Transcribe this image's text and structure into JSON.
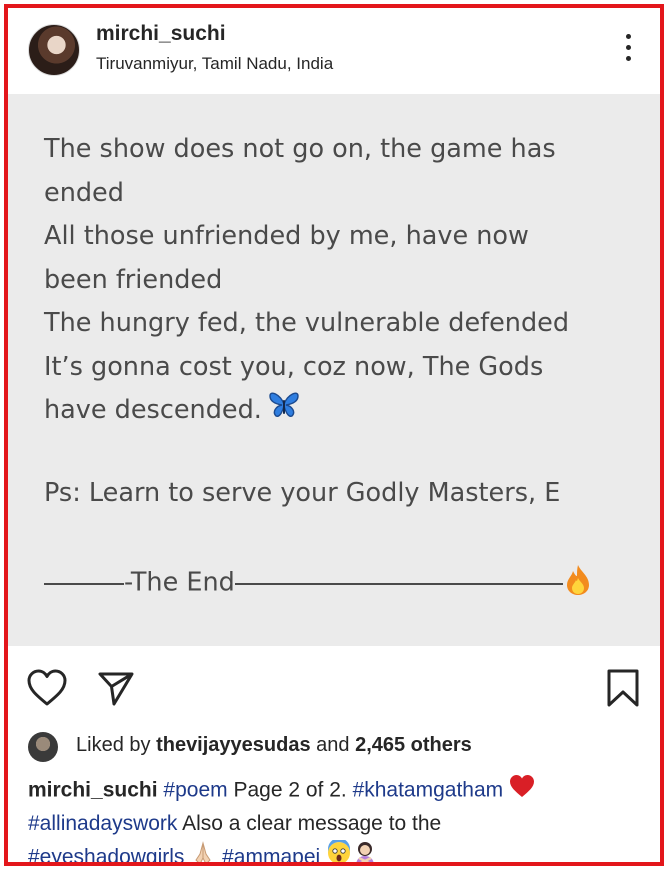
{
  "header": {
    "username": "mirchi_suchi",
    "location": "Tiruvanmiyur, Tamil Nadu, India"
  },
  "post": {
    "poem_lines": [
      "The show does not go on, the game has",
      "ended",
      "All those unfriended by me, have now",
      "been friended",
      "The hungry fed, the vulnerable defended",
      "It’s gonna cost you, coz now, The Gods",
      "have descended."
    ],
    "ps_line": "Ps: Learn to serve your Godly Masters, E",
    "end_text": "-The End",
    "background": "#ebebeb",
    "text_color": "#4a4a4a"
  },
  "actions": {
    "like_icon": "heart-icon",
    "share_icon": "send-icon",
    "save_icon": "bookmark-icon"
  },
  "likes": {
    "prefix": "Liked by ",
    "liker": "thevijayyesudas",
    "middle": " and ",
    "count": "2,465 others"
  },
  "caption": {
    "username": "mirchi_suchi",
    "tag1": "#poem",
    "text1": " Page 2 of 2. ",
    "tag2": "#khatamgatham",
    "tag3": "#allinadayswork",
    "text2": " Also a clear message to the",
    "tag4": "#eyeshadowgirls",
    "tag5": "#ammapei",
    "link_color": "#1e3a8a"
  },
  "frame_color": "#e3161b"
}
